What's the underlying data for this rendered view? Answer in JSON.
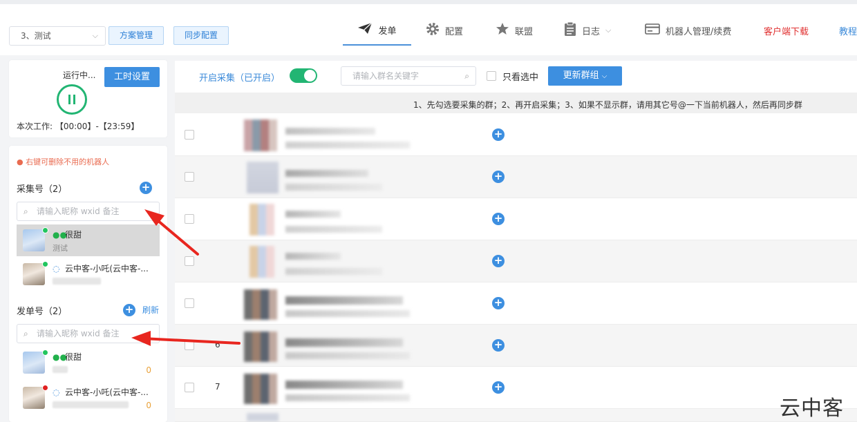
{
  "header": {
    "plan_select_value": "3、测试",
    "plan_manage_label": "方案管理",
    "sync_config_label": "同步配置",
    "nav": {
      "send": "发单",
      "config": "配置",
      "alliance": "联盟",
      "log": "日志",
      "robot": "机器人管理/续费",
      "download": "客户端下载",
      "tutorial": "教程"
    }
  },
  "status_panel": {
    "status_text": "运行中...",
    "work_time_button": "工时设置",
    "work_time_text": "本次工作: 【00:00】-【23:59】"
  },
  "accounts_panel": {
    "hint": "右键可删除不用的机器人",
    "collect_title": "采集号（2）",
    "send_title": "发单号（2）",
    "refresh_label": "刷新",
    "search_placeholder": "请输入昵称 wxid 备注",
    "collect_accounts": [
      {
        "name": "很甜",
        "sub": "测试"
      },
      {
        "name": "云中客-小吒(云中客-..."
      }
    ],
    "send_accounts": [
      {
        "name": "很甜",
        "count": "0"
      },
      {
        "name": "云中客-小吒(云中客-...",
        "count": "0"
      }
    ]
  },
  "main": {
    "collect_toggle_label": "开启采集（已开启）",
    "group_search_placeholder": "请输入群名关键字",
    "only_selected_label": "只看选中",
    "update_groups_button": "更新群组",
    "notice": "1、先勾选要采集的群；2、再开启采集；3、如果不显示群，请用其它号@一下当前机器人，然后再同步群",
    "rows": [
      {
        "num": ""
      },
      {
        "num": ""
      },
      {
        "num": ""
      },
      {
        "num": ""
      },
      {
        "num": ""
      },
      {
        "num": "6"
      },
      {
        "num": "7"
      }
    ]
  },
  "watermark": "云中客",
  "colors": {
    "accent": "#3d8fe0",
    "active_green": "#22b573",
    "download_red": "#e03030"
  }
}
